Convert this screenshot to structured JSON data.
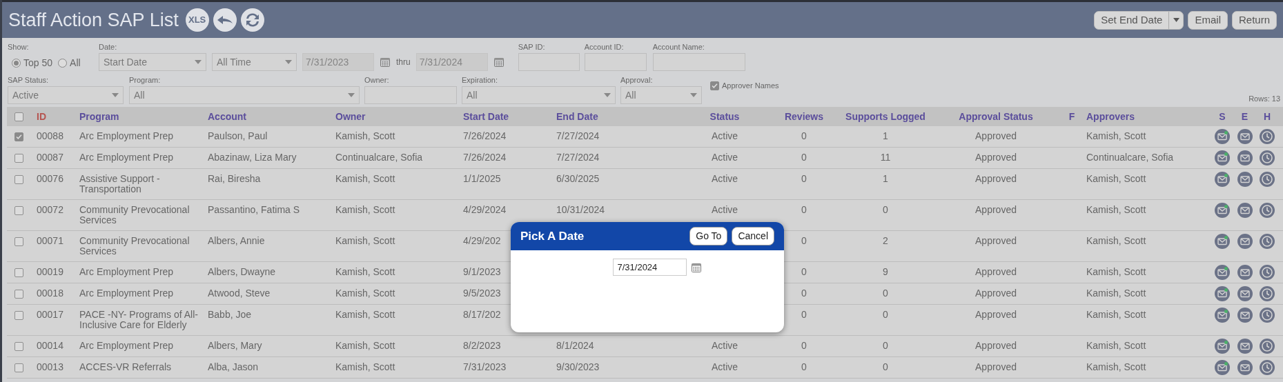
{
  "header": {
    "title": "Staff Action SAP List",
    "export_label": "XLS",
    "set_end_date": "Set End Date",
    "email": "Email",
    "return": "Return"
  },
  "filters": {
    "show_label": "Show:",
    "show_options": [
      {
        "label": "Top 50",
        "selected": true
      },
      {
        "label": "All",
        "selected": false
      }
    ],
    "date_label": "Date:",
    "date_field": "Start Date",
    "date_range": "All Time",
    "from": "7/31/2023",
    "thru": "thru",
    "to": "7/31/2024",
    "dates_disabled": true,
    "sap_id_label": "SAP ID:",
    "account_id_label": "Account ID:",
    "account_name_label": "Account Name:",
    "sap_status_label": "SAP Status:",
    "sap_status": "Active",
    "program_label": "Program:",
    "program": "All",
    "owner_label": "Owner:",
    "expiration_label": "Expiration:",
    "expiration": "All",
    "approval_label": "Approval:",
    "approval": "All",
    "approver_names": {
      "label": "Approver Names",
      "checked": true
    },
    "rows_count": "Rows: 13"
  },
  "table": {
    "select_all_checked": false,
    "columns": [
      "ID",
      "Program",
      "Account",
      "Owner",
      "Start Date",
      "End Date",
      "Status",
      "Reviews",
      "Supports Logged",
      "Approval Status",
      "F",
      "Approvers",
      "S",
      "E",
      "H"
    ],
    "rows": [
      {
        "checked": true,
        "id": "00088",
        "program": "Arc Employment Prep",
        "account": "Paulson, Paul",
        "owner": "Kamish, Scott",
        "start_date": "7/26/2024",
        "end_date": "7/27/2024",
        "status": "Active",
        "reviews": "0",
        "supports_logged": "1",
        "approval_status": "Approved",
        "approvers": "Kamish, Scott"
      },
      {
        "checked": false,
        "id": "00087",
        "program": "Arc Employment Prep",
        "account": "Abazinaw, Liza Mary",
        "owner": "Continualcare, Sofia",
        "start_date": "7/26/2024",
        "end_date": "7/27/2024",
        "status": "Active",
        "reviews": "0",
        "supports_logged": "11",
        "approval_status": "Approved",
        "approvers": "Continualcare, Sofia"
      },
      {
        "checked": false,
        "id": "00076",
        "program": "Assistive Support - Transportation",
        "account": "Rai, Biresha",
        "owner": "Kamish, Scott",
        "start_date": "1/1/2025",
        "end_date": "6/30/2025",
        "status": "Active",
        "reviews": "0",
        "supports_logged": "1",
        "approval_status": "Approved",
        "approvers": "Kamish, Scott"
      },
      {
        "checked": false,
        "id": "00072",
        "program": "Community Prevocational Services",
        "account": "Passantino, Fatima S",
        "owner": "Kamish, Scott",
        "start_date": "4/29/2024",
        "end_date": "10/31/2024",
        "status": "Active",
        "reviews": "0",
        "supports_logged": "0",
        "approval_status": "Approved",
        "approvers": "Kamish, Scott"
      },
      {
        "checked": false,
        "id": "00071",
        "program": "Community Prevocational Services",
        "account": "Albers, Annie",
        "owner": "Kamish, Scott",
        "start_date": "4/29/202",
        "reviews": "0",
        "supports_logged": "2",
        "approval_status": "Approved",
        "approvers": "Kamish, Scott"
      },
      {
        "checked": false,
        "id": "00019",
        "program": "Arc Employment Prep",
        "account": "Albers, Dwayne",
        "owner": "Kamish, Scott",
        "start_date": "9/1/2023",
        "reviews": "0",
        "supports_logged": "9",
        "approval_status": "Approved",
        "approvers": "Kamish, Scott"
      },
      {
        "checked": false,
        "id": "00018",
        "program": "Arc Employment Prep",
        "account": "Atwood, Steve",
        "owner": "Kamish, Scott",
        "start_date": "9/5/2023",
        "reviews": "0",
        "supports_logged": "0",
        "approval_status": "Approved",
        "approvers": "Kamish, Scott"
      },
      {
        "checked": false,
        "id": "00017",
        "program": "PACE -NY- Programs of All-Inclusive Care for Elderly",
        "account": "Babb, Joe",
        "owner": "Kamish, Scott",
        "start_date": "8/17/202",
        "reviews": "0",
        "supports_logged": "0",
        "approval_status": "Approved",
        "approvers": "Kamish, Scott"
      },
      {
        "checked": false,
        "id": "00014",
        "program": "Arc Employment Prep",
        "account": "Albers, Mary",
        "owner": "Kamish, Scott",
        "start_date": "8/2/2023",
        "end_date": "8/1/2024",
        "status": "Active",
        "reviews": "0",
        "supports_logged": "0",
        "approval_status": "Approved",
        "approvers": "Kamish, Scott"
      },
      {
        "checked": false,
        "id": "00013",
        "program": "ACCES-VR Referrals",
        "account": "Alba, Jason",
        "owner": "Kamish, Scott",
        "start_date": "7/31/2023",
        "end_date": "9/30/2023",
        "status": "Active",
        "reviews": "0",
        "supports_logged": "0",
        "approval_status": "Approved",
        "approvers": "Kamish, Scott"
      }
    ]
  },
  "dialog": {
    "title": "Pick A Date",
    "go_to": "Go To",
    "cancel": "Cancel",
    "date": "7/31/2024"
  }
}
